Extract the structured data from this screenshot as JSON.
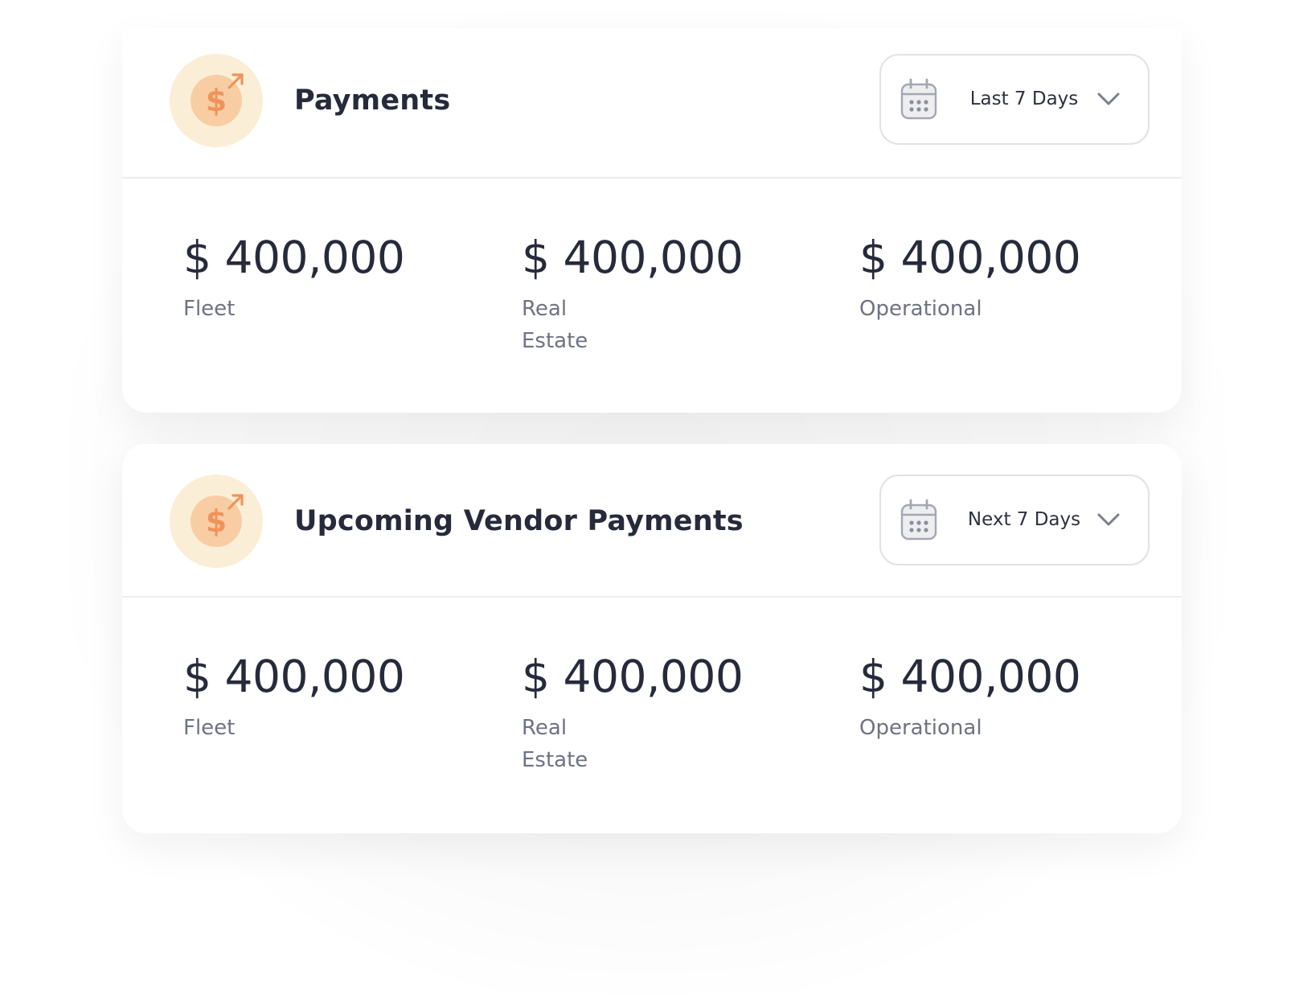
{
  "cards": [
    {
      "title": "Payments",
      "icon": "dollar-up-arrow-icon",
      "range": {
        "label": "Last 7 Days",
        "icon": "calendar-icon"
      },
      "stats": [
        {
          "amount": "$ 400,000",
          "label": "Fleet"
        },
        {
          "amount": "$ 400,000",
          "label": "Real Estate"
        },
        {
          "amount": "$ 400,000",
          "label": "Operational"
        }
      ]
    },
    {
      "title": "Upcoming Vendor Payments",
      "icon": "dollar-up-arrow-icon",
      "range": {
        "label": "Next 7 Days",
        "icon": "calendar-icon"
      },
      "stats": [
        {
          "amount": "$ 400,000",
          "label": "Fleet"
        },
        {
          "amount": "$ 400,000",
          "label": "Real Estate"
        },
        {
          "amount": "$ 400,000",
          "label": "Operational"
        }
      ]
    }
  ],
  "colors": {
    "accent": "#f0935a",
    "badge_outer": "#fbeed6",
    "badge_inner": "#f8cda4",
    "title": "#262a3a",
    "label": "#6e7283",
    "border": "#e2e2e6"
  },
  "dollar_glyph": "$"
}
